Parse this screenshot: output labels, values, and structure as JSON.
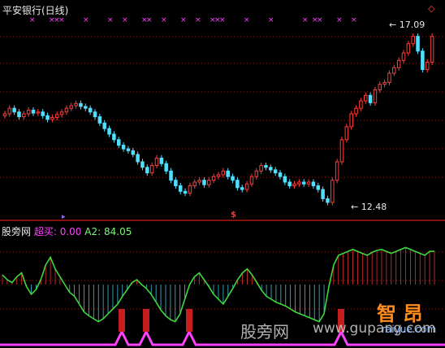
{
  "window": {
    "title": "平安银行(日线)"
  },
  "price_panel": {
    "high_label": "17.09",
    "low_label": "12.48",
    "marks": {
      "top_cross": "×",
      "corner": "◇",
      "buy_signal": "$"
    }
  },
  "indicator_panel": {
    "name": "股旁网",
    "k1": "超买:",
    "v1": "0.00",
    "k2": "A2:",
    "v2": "84.05"
  },
  "watermark": {
    "text1": "股旁网",
    "text2": "www.gupang.com",
    "logo_text": "智 昂",
    "logo_url": "raiyue.com"
  },
  "colors": {
    "up": "#ff3b3b",
    "down": "#4fe0ff",
    "indicator_line": "#3ed83e",
    "signal_line": "#ff40ff",
    "grid": "#8b1d1d",
    "divider": "#b01515"
  },
  "chart_data": [
    {
      "type": "candlestick",
      "title": "平安银行(日线)",
      "annotations": [
        {
          "label": "17.09",
          "kind": "high"
        },
        {
          "label": "12.48",
          "kind": "low"
        }
      ],
      "close": [
        14.9,
        15.05,
        14.95,
        14.82,
        14.9,
        15.0,
        14.92,
        14.95,
        14.85,
        14.75,
        14.8,
        14.88,
        14.95,
        15.05,
        15.12,
        15.18,
        15.1,
        15.05,
        14.95,
        14.82,
        14.65,
        14.5,
        14.35,
        14.2,
        14.05,
        13.95,
        13.9,
        13.8,
        13.6,
        13.45,
        13.3,
        13.5,
        13.7,
        13.55,
        13.35,
        13.1,
        12.95,
        12.8,
        12.75,
        12.95,
        13.05,
        13.1,
        12.98,
        13.1,
        13.2,
        13.25,
        13.35,
        13.2,
        13.1,
        12.9,
        12.85,
        13.0,
        13.2,
        13.35,
        13.5,
        13.45,
        13.38,
        13.3,
        13.2,
        13.05,
        12.95,
        13.0,
        13.05,
        13.0,
        13.05,
        12.95,
        12.85,
        12.6,
        12.5,
        13.1,
        13.6,
        14.2,
        14.55,
        14.9,
        15.05,
        15.25,
        15.4,
        15.2,
        15.55,
        15.7,
        15.75,
        16.0,
        16.15,
        16.35,
        16.55,
        16.8,
        17.0,
        16.6,
        16.1,
        16.3,
        17.0
      ],
      "ylim": [
        12.3,
        17.5
      ]
    },
    {
      "type": "line",
      "series": [
        {
          "name": "超买",
          "values": [
            0,
            0,
            0,
            0,
            0,
            0,
            0,
            0,
            0,
            0,
            0,
            0,
            0,
            0,
            0,
            0,
            0,
            0,
            0,
            0,
            0,
            0,
            0,
            0,
            0,
            0,
            0,
            0,
            0,
            0,
            0,
            0,
            0,
            0,
            0,
            0,
            0,
            0,
            0,
            0,
            0,
            0,
            0,
            0,
            0,
            0,
            0,
            0,
            0,
            0,
            0,
            0,
            0,
            0,
            0,
            0,
            0,
            0,
            0,
            0,
            0,
            0,
            0,
            0,
            0,
            0,
            0,
            0,
            0,
            0,
            0,
            0,
            0,
            0,
            0,
            0,
            0,
            0,
            0,
            0,
            0,
            0,
            0,
            0,
            0,
            0,
            0,
            0,
            0,
            0,
            0
          ]
        },
        {
          "name": "A2",
          "values": [
            60,
            55,
            52,
            58,
            62,
            48,
            40,
            45,
            55,
            70,
            78,
            66,
            58,
            50,
            42,
            38,
            30,
            22,
            18,
            15,
            12,
            15,
            20,
            25,
            30,
            38,
            45,
            52,
            55,
            50,
            46,
            40,
            32,
            24,
            18,
            14,
            12,
            20,
            35,
            50,
            58,
            62,
            55,
            48,
            40,
            35,
            30,
            38,
            46,
            55,
            62,
            66,
            60,
            52,
            44,
            38,
            35,
            32,
            30,
            28,
            25,
            22,
            20,
            18,
            16,
            14,
            12,
            20,
            48,
            70,
            80,
            82,
            84,
            86,
            84,
            82,
            80,
            83,
            85,
            86,
            84,
            82,
            84,
            86,
            88,
            86,
            84,
            82,
            80,
            84,
            84.05
          ]
        }
      ],
      "ylim": [
        0,
        100
      ]
    }
  ]
}
